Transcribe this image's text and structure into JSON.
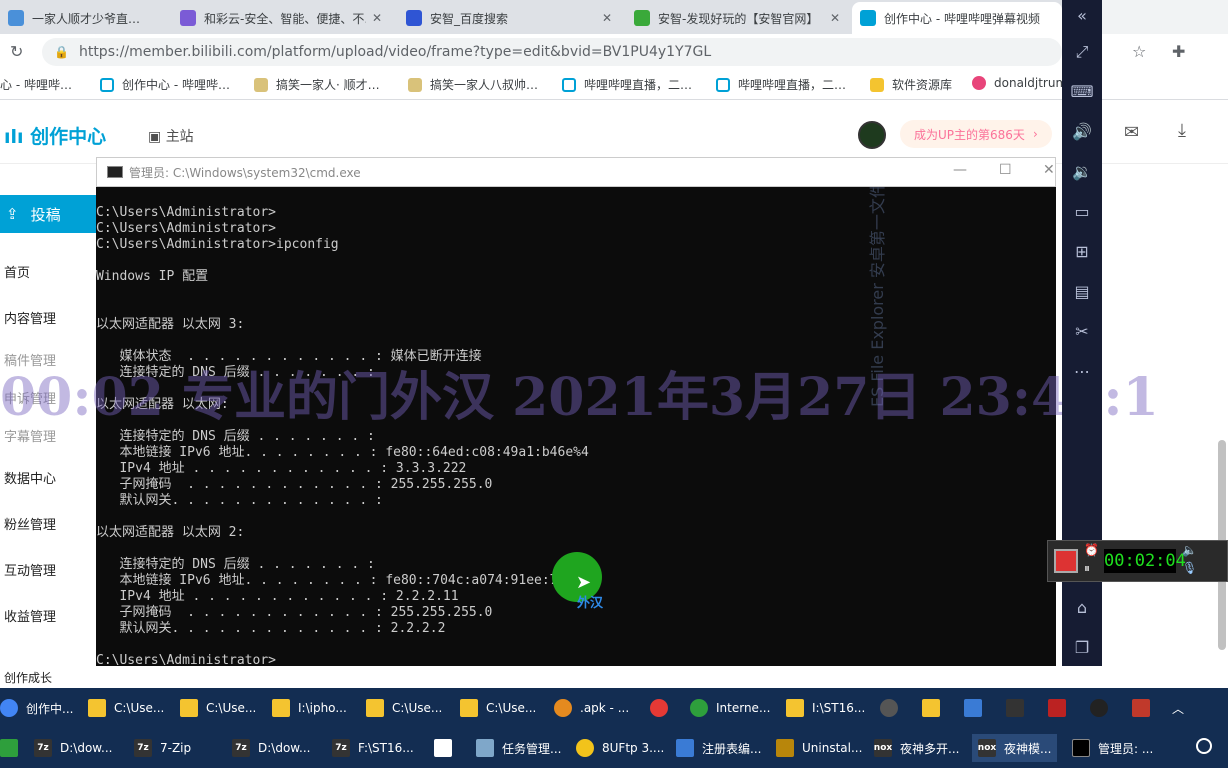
{
  "tabs": [
    {
      "title": "一家人顺才少爷直…"
    },
    {
      "title": "和彩云-安全、智能、便捷、不…"
    },
    {
      "title": "安智_百度搜索"
    },
    {
      "title": "安智-发现好玩的【安智官网】"
    },
    {
      "title": "创作中心 - 哔哩哔哩弹幕视频"
    }
  ],
  "address": {
    "url": "https://member.bilibili.com/platform/upload/video/frame?type=edit&bvid=BV1PU4y1Y7GL"
  },
  "bookmarks": [
    {
      "label": "心 - 哔哩哔…"
    },
    {
      "label": "创作中心 - 哔哩哔…"
    },
    {
      "label": "搞笑一家人· 顺才…"
    },
    {
      "label": "搞笑一家人八叔帅…"
    },
    {
      "label": "哔哩哔哩直播，二…"
    },
    {
      "label": "哔哩哔哩直播，二…"
    },
    {
      "label": "软件资源库"
    },
    {
      "label": "donaldjtrum…"
    }
  ],
  "bili": {
    "logo": "创作中心",
    "home": "主站",
    "up_badge": "成为UP主的第686天",
    "upload_btn": "投稿",
    "nav": [
      {
        "label": "首页"
      },
      {
        "label": "内容管理"
      },
      {
        "label": "稿件管理"
      },
      {
        "label": "申诉管理"
      },
      {
        "label": "字幕管理"
      },
      {
        "label": "数据中心"
      },
      {
        "label": "粉丝管理"
      },
      {
        "label": "互动管理"
      },
      {
        "label": "收益管理"
      }
    ],
    "status_text": "创作成长",
    "watermark": "00:02 专业的门外汉 2021年3月27日 23:45:1"
  },
  "cmd": {
    "title": "管理员: C:\\Windows\\system32\\cmd.exe",
    "output": "C:\\Users\\Administrator>\nC:\\Users\\Administrator>\nC:\\Users\\Administrator>ipconfig\n\nWindows IP 配置\n\n\n以太网适配器 以太网 3:\n\n   媒体状态  . . . . . . . . . . . . : 媒体已断开连接\n   连接特定的 DNS 后缀 . . . . . . . :\n\n以太网适配器 以太网:\n\n   连接特定的 DNS 后缀 . . . . . . . :\n   本地链接 IPv6 地址. . . . . . . . : fe80::64ed:c08:49a1:b46e%4\n   IPv4 地址 . . . . . . . . . . . . : 3.3.3.222\n   子网掩码  . . . . . . . . . . . . : 255.255.255.0\n   默认网关. . . . . . . . . . . . . :\n\n以太网适配器 以太网 2:\n\n   连接特定的 DNS 后缀 . . . . . . . :\n   本地链接 IPv6 地址. . . . . . . . : fe80::704c:a074:91ee:7bf%13\n   IPv4 地址 . . . . . . . . . . . . : 2.2.2.11\n   子网掩码  . . . . . . . . . . . . : 255.255.255.0\n   默认网关. . . . . . . . . . . . . : 2.2.2.2\n\nC:\\Users\\Administrator>",
    "bg_text": "ES File Explorer  安卓第一文件管理器",
    "cursor_label": "外汉"
  },
  "recorder": {
    "time": "00:02:04"
  },
  "taskbar1": [
    {
      "label": "创作中..."
    },
    {
      "label": "C:\\Use..."
    },
    {
      "label": "C:\\Use..."
    },
    {
      "label": "I:\\ipho..."
    },
    {
      "label": "C:\\Use..."
    },
    {
      "label": "C:\\Use..."
    },
    {
      "label": ".apk - ..."
    },
    {
      "label": "Interne..."
    },
    {
      "label": "I:\\ST16..."
    }
  ],
  "taskbar2": [
    {
      "label": "D:\\dow..."
    },
    {
      "label": "7-Zip"
    },
    {
      "label": "D:\\dow..."
    },
    {
      "label": "F:\\ST16..."
    },
    {
      "label": "任务管理..."
    },
    {
      "label": "8UFtp 3...."
    },
    {
      "label": "注册表编..."
    },
    {
      "label": "Uninstal..."
    },
    {
      "label": "夜神多开..."
    },
    {
      "label": "夜神模..."
    },
    {
      "label": "管理员: ..."
    }
  ],
  "colors": {
    "bili_blue": "#00a1d6",
    "taskbar": "#132d52",
    "cmd_bg": "#0c0c0c"
  }
}
